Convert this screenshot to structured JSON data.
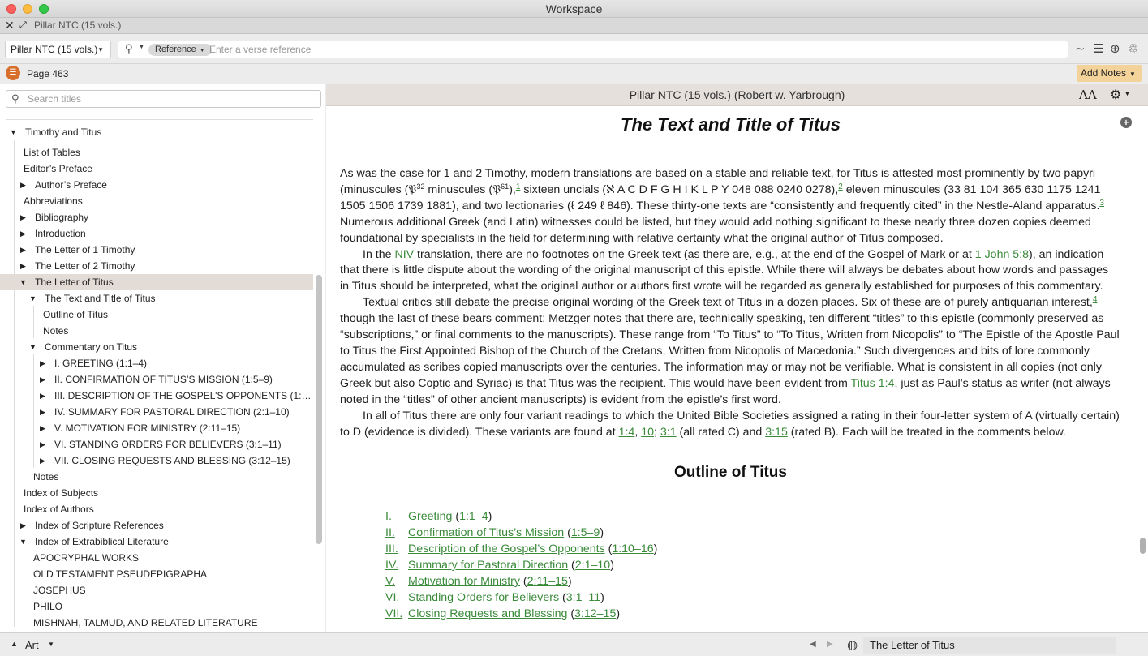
{
  "window": {
    "title": "Workspace"
  },
  "tab": {
    "label": "Pillar NTC (15 vols.)"
  },
  "toolbar": {
    "resource": "Pillar NTC (15 vols.)",
    "reference_pill": "Reference",
    "search_placeholder": "Enter a verse reference"
  },
  "pagebar": {
    "page_label": "Page 463",
    "add_notes": "Add Notes"
  },
  "sidebar": {
    "search_placeholder": "Search titles",
    "items": [
      {
        "label": "Timothy and Titus"
      },
      {
        "label": "List of Tables"
      },
      {
        "label": "Editor’s Preface"
      },
      {
        "label": "Author’s Preface"
      },
      {
        "label": "Abbreviations"
      },
      {
        "label": "Bibliography"
      },
      {
        "label": "Introduction"
      },
      {
        "label": "The Letter of 1 Timothy"
      },
      {
        "label": "The Letter of 2 Timothy"
      },
      {
        "label": "The Letter of Titus"
      },
      {
        "label": "The Text and Title of Titus"
      },
      {
        "label": "Outline of Titus"
      },
      {
        "label": "Notes"
      },
      {
        "label": "Commentary on Titus"
      },
      {
        "label": "I. GREETING (1:1–4)"
      },
      {
        "label": "II. CONFIRMATION OF TITUS’S MISSION (1:5–9)"
      },
      {
        "label": "III. DESCRIPTION OF THE GOSPEL’S OPPONENTS (1:10–16)"
      },
      {
        "label": "IV. SUMMARY FOR PASTORAL DIRECTION (2:1–10)"
      },
      {
        "label": "V. MOTIVATION FOR MINISTRY (2:11–15)"
      },
      {
        "label": "VI. STANDING ORDERS FOR BELIEVERS (3:1–11)"
      },
      {
        "label": "VII. CLOSING REQUESTS AND BLESSING (3:12–15)"
      },
      {
        "label": "Notes"
      },
      {
        "label": "Index of Subjects"
      },
      {
        "label": "Index of Authors"
      },
      {
        "label": "Index of Scripture References"
      },
      {
        "label": "Index of Extrabiblical Literature"
      },
      {
        "label": "APOCRYPHAL WORKS"
      },
      {
        "label": "OLD TESTAMENT PSEUDEPIGRAPHA"
      },
      {
        "label": "JOSEPHUS"
      },
      {
        "label": "PHILO"
      },
      {
        "label": "MISHNAH, TALMUD, AND RELATED LITERATURE"
      }
    ]
  },
  "content": {
    "header": "Pillar NTC (15 vols.) (Robert w. Yarbrough)",
    "font_size_label": "AA",
    "title": "The Text and Title of Titus",
    "p1": {
      "a": "As was the case for 1 and 2 Timothy, modern translations are based on a stable and reliable text, for Titus is attested most prominently by two papyri (minuscules (",
      "pap1": "𝔓",
      "pap1_sup": "32",
      "b": " minuscules (",
      "pap2": "𝔓",
      "pap2_sup": "61",
      "c": "),",
      "fn1": "1",
      "d": " sixteen uncials (ℵ A C D F G H I K L P Y 048 088 0240 0278),",
      "fn2": "2",
      "e": " eleven minuscules (33 81 104 365 630 1175 1241 1505 1506 1739 1881), and two lectionaries (ℓ 249 ℓ 846). These thirty-one texts are “consistently and frequently cited” in the Nestle-Aland apparatus.",
      "fn3": "3",
      "f": " Numerous additional Greek (and Latin) witnesses could be listed, but they would add nothing significant to these nearly three dozen copies deemed foundational by specialists in the field for determining with relative certainty what the original author of Titus composed."
    },
    "p2": {
      "a": "In the ",
      "niv": "NIV",
      "b": " translation, there are no footnotes on the Greek text (as there are, e.g., at the end of the Gospel of Mark or at ",
      "ref": "1 John 5:8",
      "c": "), an indication that there is little dispute about the wording of the original manuscript of this epistle. While there will always be debates about how words and passages in Titus should be interpreted, what the original author or authors first wrote will be regarded as generally established for purposes of this commentary."
    },
    "p3": {
      "a": "Textual critics still debate the precise original wording of the Greek text of Titus in a dozen places. Six of these are of purely antiquarian interest,",
      "fn4": "4",
      "b": " though the last of these bears comment: Metzger notes that there are, technically speaking, ten different “titles” to this epistle (commonly preserved as “subscriptions,” or final comments to the manuscripts). These range from “To Titus” to “To Titus, Written from Nicopolis” to “The Epistle of the Apostle Paul to Titus the First Appointed Bishop of the Church of the Cretans, Written from Nicopolis of Macedonia.” Such divergences and bits of lore commonly accumulated as scribes copied manuscripts over the centuries. The information may or may not be verifiable. What is consistent in all copies (not only Greek but also Coptic and Syriac) is that Titus was the recipient. This would have been evident from ",
      "ref": "Titus 1:4",
      "c": ", just as Paul’s status as writer (not always noted in the “titles” of other ancient manuscripts) is evident from the epistle’s first word."
    },
    "p4": {
      "a": "In all of Titus there are only four variant readings to which the United Bible Societies assigned a rating in their four-letter system of A (virtually certain) to D (evidence is divided). These variants are found at ",
      "r1": "1:4",
      "s1": ", ",
      "r2": "10",
      "s2": "; ",
      "r3": "3:1",
      "b": " (all rated C) and ",
      "r4": "3:15",
      "c": " (rated B). Each will be treated in the comments below."
    },
    "outline_heading": "Outline of Titus",
    "outline": [
      {
        "num": "I.",
        "title": "Greeting",
        "ref": "1:1–4"
      },
      {
        "num": "II.",
        "title": "Confirmation of Titus’s Mission",
        "ref": "1:5–9"
      },
      {
        "num": "III.",
        "title": "Description of the Gospel’s Opponents",
        "ref": "1:10–16"
      },
      {
        "num": "IV.",
        "title": "Summary for Pastoral Direction",
        "ref": "2:1–10"
      },
      {
        "num": "V.",
        "title": "Motivation for Ministry",
        "ref": "2:11–15"
      },
      {
        "num": "VI.",
        "title": "Standing Orders for Believers",
        "ref": "3:1–11"
      },
      {
        "num": "VII.",
        "title": "Closing Requests and Blessing",
        "ref": "3:12–15"
      }
    ]
  },
  "statusbar": {
    "layout": "Art",
    "location": "The Letter of Titus"
  },
  "colors": {
    "link": "#3a8a3a",
    "selected_row": "#e3dbd5",
    "add_notes_bg": "#f3d39a",
    "toc_button": "#d96f2c"
  }
}
